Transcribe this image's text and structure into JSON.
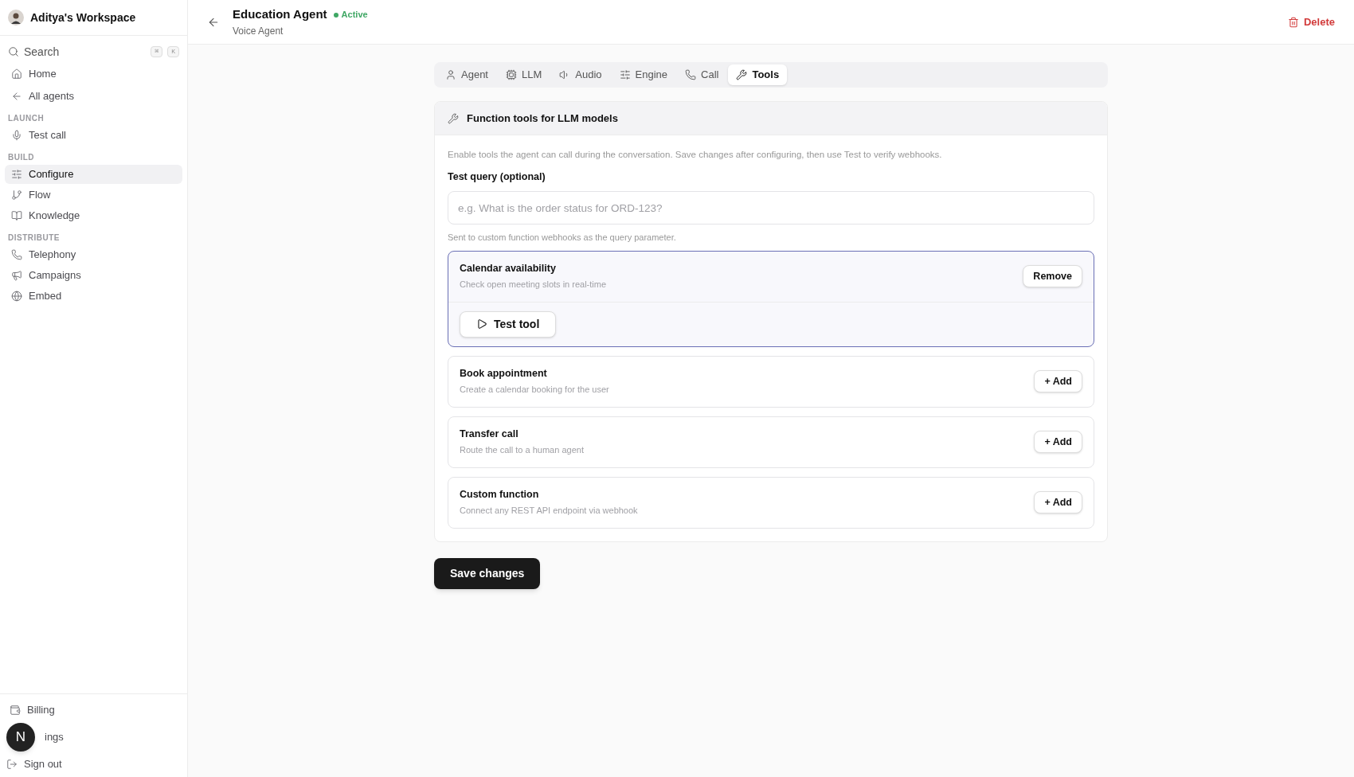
{
  "sidebar": {
    "workspace": "Aditya's Workspace",
    "search": {
      "placeholder": "Search",
      "keys": [
        "⌘",
        "K"
      ]
    },
    "top_items": [
      {
        "label": "Home",
        "kind": "home",
        "selected": false
      },
      {
        "label": "All agents",
        "kind": "back",
        "selected": false
      }
    ],
    "sections": [
      {
        "title": "LAUNCH",
        "items": [
          {
            "label": "Test call",
            "kind": "mic",
            "selected": false
          }
        ]
      },
      {
        "title": "BUILD",
        "items": [
          {
            "label": "Configure",
            "kind": "sliders",
            "selected": true
          },
          {
            "label": "Flow",
            "kind": "flow",
            "selected": false
          },
          {
            "label": "Knowledge",
            "kind": "book",
            "selected": false
          }
        ]
      },
      {
        "title": "DISTRIBUTE",
        "items": [
          {
            "label": "Telephony",
            "kind": "phone",
            "selected": false
          },
          {
            "label": "Campaigns",
            "kind": "megaphone",
            "selected": false
          },
          {
            "label": "Embed",
            "kind": "globe",
            "selected": false
          }
        ]
      }
    ],
    "bottom_items": [
      {
        "label": "Billing",
        "kind": "wallet"
      },
      {
        "label": "ings"
      },
      {
        "label": "Sign out",
        "kind": "logout"
      }
    ],
    "badge": "N"
  },
  "header": {
    "title": "Education Agent",
    "subtitle": "Voice Agent",
    "status": "Active",
    "delete": "Delete"
  },
  "tabs": [
    {
      "label": "Agent",
      "kind": "user",
      "selected": false
    },
    {
      "label": "LLM",
      "kind": "cpu",
      "selected": false
    },
    {
      "label": "Audio",
      "kind": "volume",
      "selected": false
    },
    {
      "label": "Engine",
      "kind": "sliders",
      "selected": false
    },
    {
      "label": "Call",
      "kind": "phone",
      "selected": false
    },
    {
      "label": "Tools",
      "kind": "wrench",
      "selected": true
    }
  ],
  "panel": {
    "title": "Function tools for LLM models",
    "description": "Enable tools the agent can call during the conversation. Save changes after configuring, then use Test to verify webhooks.",
    "query_label": "Test query (optional)",
    "query_placeholder": "e.g. What is the order status for ORD-123?",
    "query_hint": "Sent to custom function webhooks as the query parameter.",
    "tools": [
      {
        "name": "Calendar availability",
        "description": "Check open meeting slots in real-time",
        "enabled": true,
        "action": "Remove",
        "test": "Test tool"
      },
      {
        "name": "Book appointment",
        "description": "Create a calendar booking for the user",
        "enabled": false,
        "action": "+ Add"
      },
      {
        "name": "Transfer call",
        "description": "Route the call to a human agent",
        "enabled": false,
        "action": "+ Add"
      },
      {
        "name": "Custom function",
        "description": "Connect any REST API endpoint via webhook",
        "enabled": false,
        "action": "+ Add"
      }
    ]
  },
  "save": "Save changes"
}
